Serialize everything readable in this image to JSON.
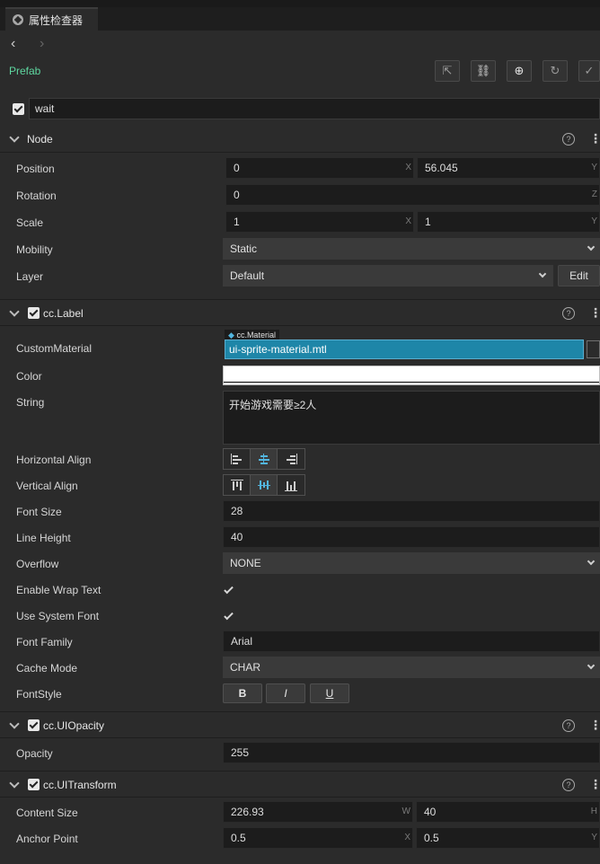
{
  "tab": {
    "title": "属性检查器"
  },
  "nav": {
    "back": "‹",
    "forward": "›"
  },
  "prefab": {
    "label": "Prefab"
  },
  "node_name": "wait",
  "sections": {
    "node": "Node",
    "label": "cc.Label",
    "opacity": "cc.UIOpacity",
    "transform": "cc.UITransform"
  },
  "help_glyph": "?",
  "node": {
    "position_label": "Position",
    "position_x": "0",
    "position_y": "56.045",
    "rotation_label": "Rotation",
    "rotation": "0",
    "scale_label": "Scale",
    "scale_x": "1",
    "scale_y": "1",
    "mobility_label": "Mobility",
    "mobility": "Static",
    "layer_label": "Layer",
    "layer": "Default",
    "edit": "Edit",
    "axis_x": "X",
    "axis_y": "Y",
    "axis_z": "Z"
  },
  "label": {
    "custom_material_label": "CustomMaterial",
    "material_type": "cc.Material",
    "material_value": "ui-sprite-material.mtl",
    "color_label": "Color",
    "string_label": "String",
    "string_value": "开始游戏需要≥2人",
    "halign_label": "Horizontal Align",
    "valign_label": "Vertical Align",
    "font_size_label": "Font Size",
    "font_size": "28",
    "line_height_label": "Line Height",
    "line_height": "40",
    "overflow_label": "Overflow",
    "overflow": "NONE",
    "wrap_label": "Enable Wrap Text",
    "system_font_label": "Use System Font",
    "font_family_label": "Font Family",
    "font_family": "Arial",
    "cache_mode_label": "Cache Mode",
    "cache_mode": "CHAR",
    "font_style_label": "FontStyle",
    "bold": "B",
    "italic": "I",
    "underline": "U"
  },
  "opacity": {
    "label": "Opacity",
    "value": "255"
  },
  "transform": {
    "content_size_label": "Content Size",
    "width": "226.93",
    "height": "40",
    "anchor_label": "Anchor Point",
    "anchor_x": "0.5",
    "anchor_y": "0.5",
    "axis_w": "W",
    "axis_h": "H",
    "axis_x": "X",
    "axis_y": "Y"
  },
  "colors": {
    "accent": "#5fd7a0",
    "material_bg": "#1e86a8",
    "active_icon": "#52b6e0",
    "color_swatch": "#ffffff"
  }
}
